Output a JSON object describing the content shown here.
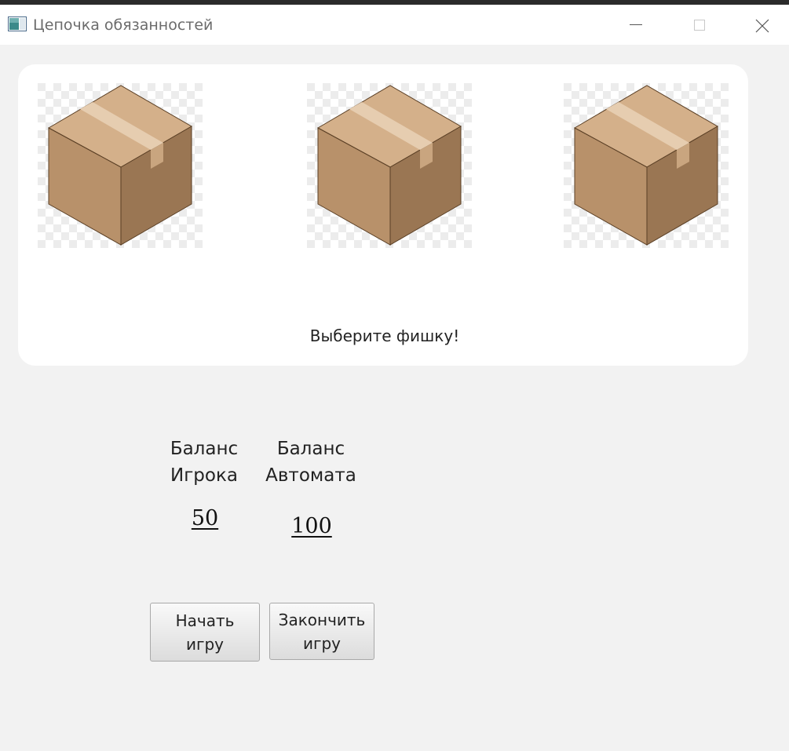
{
  "window": {
    "title": "Цепочка обязанностей"
  },
  "icons": {
    "app": "app-icon",
    "minimize": "minimize-icon",
    "maximize": "maximize-icon",
    "close": "close-icon"
  },
  "chips": [
    {
      "name": "box-chip-1",
      "icon": "cardboard-box"
    },
    {
      "name": "box-chip-2",
      "icon": "cardboard-box"
    },
    {
      "name": "box-chip-3",
      "icon": "cardboard-box"
    }
  ],
  "status_text": "Выберите фишку!",
  "balance": {
    "player_label_line1": "Баланс",
    "player_label_line2": "Игрока",
    "player_value": "50",
    "machine_label_line1": "Баланс",
    "machine_label_line2": "Автомата",
    "machine_value": "100"
  },
  "buttons": {
    "start_line1": "Начать",
    "start_line2": "игру",
    "end_line1": "Закончить",
    "end_line2": "игру"
  },
  "colors": {
    "titlebar": "#ffffff",
    "background": "#f2f2f2",
    "card": "#ffffff",
    "box_top": "#d4b08a",
    "box_left": "#b8916a",
    "box_right": "#9a7653"
  }
}
